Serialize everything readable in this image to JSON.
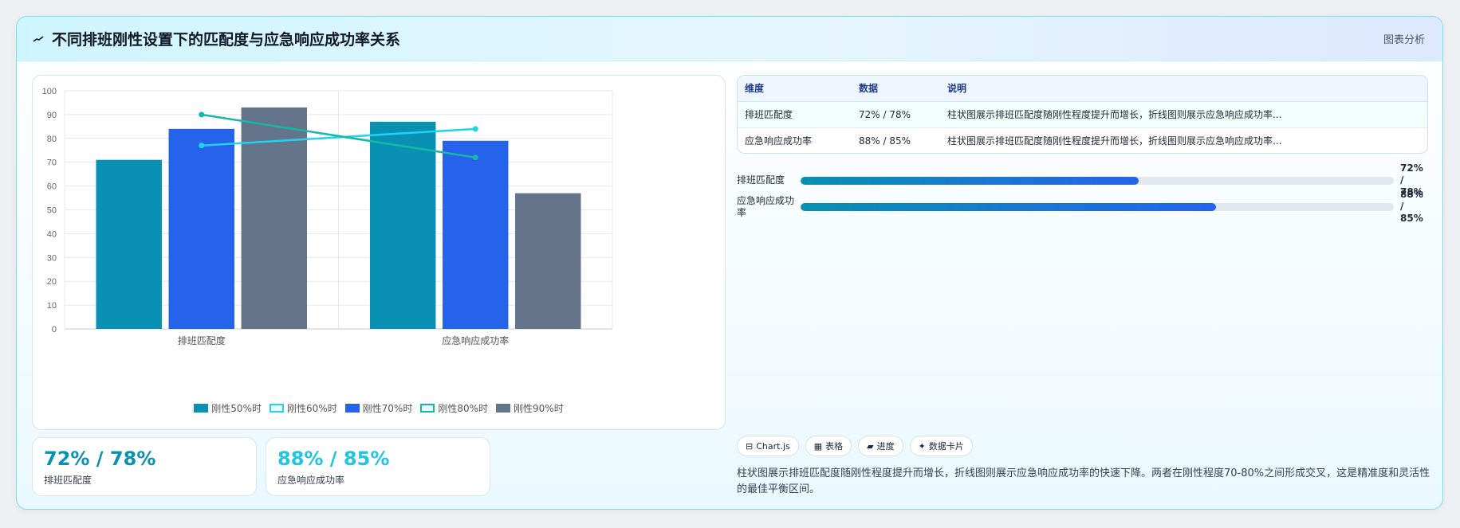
{
  "header": {
    "title": "不同排班刚性设置下的匹配度与应急响应成功率关系",
    "right_label": "图表分析"
  },
  "chart_data": {
    "type": "bar",
    "categories": [
      "排班匹配度",
      "应急响应成功率"
    ],
    "ylim": [
      0,
      100
    ],
    "yticks": [
      0,
      10,
      20,
      30,
      40,
      50,
      60,
      70,
      80,
      90,
      100
    ],
    "grid": true,
    "legend_position": "bottom",
    "series": [
      {
        "name": "刚性50%时",
        "kind": "bar",
        "color": "#0891b2",
        "values": [
          71,
          87
        ]
      },
      {
        "name": "刚性60%时",
        "kind": "line",
        "color": "#22d3ee",
        "values": [
          77,
          84
        ]
      },
      {
        "name": "刚性70%时",
        "kind": "bar",
        "color": "#2563eb",
        "values": [
          84,
          79
        ]
      },
      {
        "name": "刚性80%时",
        "kind": "line",
        "color": "#14b8a6",
        "values": [
          90,
          72
        ]
      },
      {
        "name": "刚性90%时",
        "kind": "bar",
        "color": "#64748b",
        "values": [
          93,
          57
        ]
      }
    ]
  },
  "stats": [
    {
      "value": "72% / 78%",
      "label": "排班匹配度",
      "color": "#0891b2"
    },
    {
      "value": "88% / 85%",
      "label": "应急响应成功率",
      "color": "#22c4e0"
    }
  ],
  "table": {
    "headers": [
      "维度",
      "数据",
      "说明"
    ],
    "rows": [
      [
        "排班匹配度",
        "72% / 78%",
        "柱状图展示排班匹配度随刚性程度提升而增长，折线图则展示应急响应成功率..."
      ],
      [
        "应急响应成功率",
        "88% / 85%",
        "柱状图展示排班匹配度随刚性程度提升而增长，折线图则展示应急响应成功率..."
      ]
    ]
  },
  "progress": [
    {
      "label": "排班匹配度",
      "value": "72% / 78%",
      "fill": 0.57
    },
    {
      "label": "应急响应成功率",
      "value": "88% / 85%",
      "fill": 0.7
    }
  ],
  "chips": [
    {
      "icon": "⊟",
      "label": "Chart.js"
    },
    {
      "icon": "▦",
      "label": "表格"
    },
    {
      "icon": "▰",
      "label": "进度"
    },
    {
      "icon": "✦",
      "label": "数据卡片"
    }
  ],
  "note": "柱状图展示排班匹配度随刚性程度提升而增长，折线图则展示应急响应成功率的快速下降。两者在刚性程度70-80%之间形成交叉，这是精准度和灵活性的最佳平衡区间。"
}
